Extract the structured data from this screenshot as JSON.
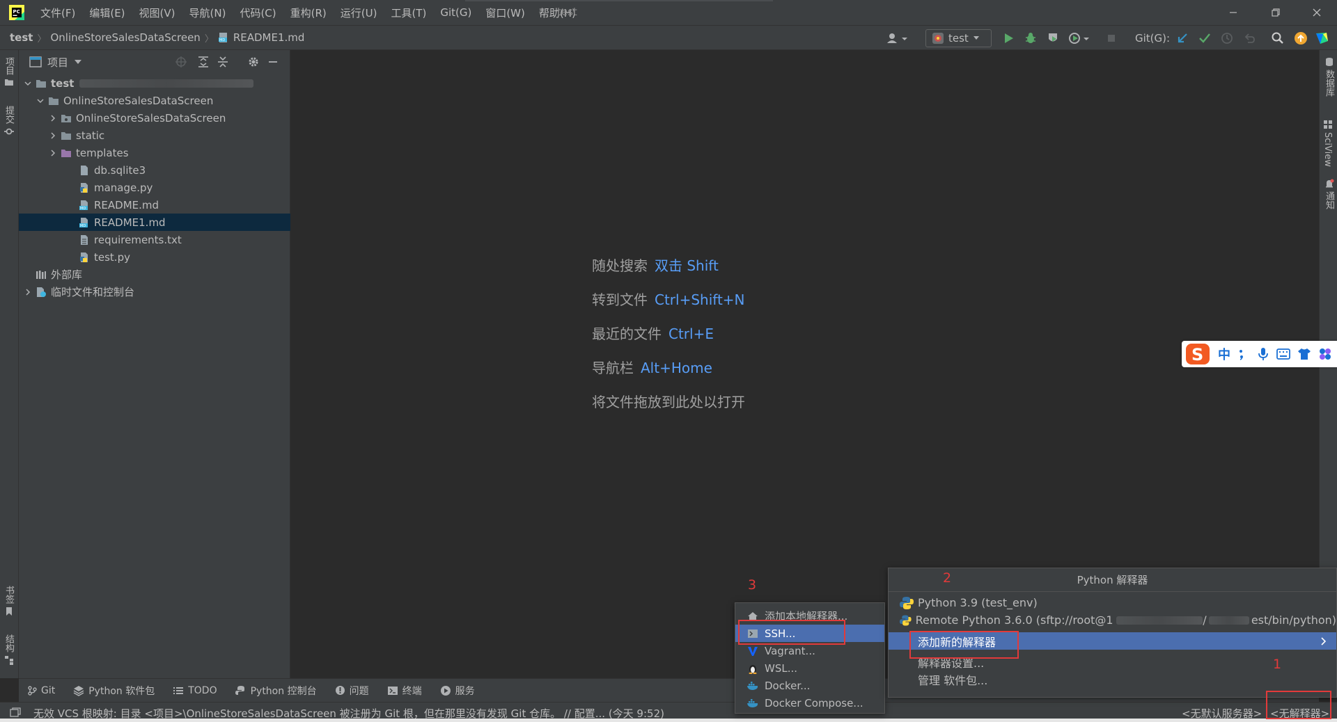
{
  "app": {
    "window_title": "test",
    "menu": [
      "文件(F)",
      "编辑(E)",
      "视图(V)",
      "导航(N)",
      "代码(C)",
      "重构(R)",
      "运行(U)",
      "工具(T)",
      "Git(G)",
      "窗口(W)",
      "帮助(H)"
    ]
  },
  "breadcrumb": {
    "project": "test",
    "folder": "OnlineStoreSalesDataScreen",
    "file": "README1.md"
  },
  "toolbar": {
    "run_config": "test",
    "git_label": "Git(G):"
  },
  "left_tabs": {
    "project": "项目",
    "commit": "提交",
    "bookmarks": "书签",
    "structure": "结构"
  },
  "right_tabs": {
    "database": "数据库",
    "sciview": "SciView",
    "notifications": "通知"
  },
  "project_panel": {
    "title": "项目",
    "tree": [
      {
        "label": "test",
        "type": "root"
      },
      {
        "label": "OnlineStoreSalesDataScreen",
        "type": "folder-open"
      },
      {
        "label": "OnlineStoreSalesDataScreen",
        "type": "folder"
      },
      {
        "label": "static",
        "type": "folder"
      },
      {
        "label": "templates",
        "type": "folder-purple"
      },
      {
        "label": "db.sqlite3",
        "type": "file"
      },
      {
        "label": "manage.py",
        "type": "python"
      },
      {
        "label": "README.md",
        "type": "markdown"
      },
      {
        "label": "README1.md",
        "type": "markdown",
        "selected": true
      },
      {
        "label": "requirements.txt",
        "type": "text"
      },
      {
        "label": "test.py",
        "type": "python"
      },
      {
        "label": "外部库",
        "type": "library"
      },
      {
        "label": "临时文件和控制台",
        "type": "scratch"
      }
    ]
  },
  "editor_hints": [
    {
      "text": "随处搜索",
      "key": "双击 Shift"
    },
    {
      "text": "转到文件",
      "key": "Ctrl+Shift+N"
    },
    {
      "text": "最近的文件",
      "key": "Ctrl+E"
    },
    {
      "text": "导航栏",
      "key": "Alt+Home"
    },
    {
      "text": "将文件拖放到此处以打开",
      "key": ""
    }
  ],
  "bottom_tools": [
    "Git",
    "Python 软件包",
    "TODO",
    "Python 控制台",
    "问题",
    "终端",
    "服务"
  ],
  "status": {
    "message": "无效 VCS 根映射: 目录 <项目>\\OnlineStoreSalesDataScreen 被注册为 Git 根，但在那里没有发现 Git 仓库。 // 配置... (今天 9:52)",
    "server": "<无默认服务器>",
    "interpreter": "<无解释器>"
  },
  "interpreter_popup": {
    "title": "Python 解释器",
    "items": [
      "Python 3.9 (test_env)",
      "Remote Python 3.6.0 (sftp://root@1",
      "添加新的解释器",
      "解释器设置...",
      "管理 软件包..."
    ],
    "remote_suffix": "/",
    "remote_path_end": "est/bin/python)"
  },
  "add_interpreter_popup": {
    "items": [
      "添加本地解释器...",
      "SSH...",
      "Vagrant...",
      "WSL...",
      "Docker...",
      "Docker Compose..."
    ]
  },
  "annotations": [
    "1",
    "2",
    "3"
  ],
  "ime": {
    "lang": "中"
  },
  "colors": {
    "accent_blue": "#589df6",
    "selection": "#4b6eaf",
    "annotation_red": "#e23a3a"
  }
}
